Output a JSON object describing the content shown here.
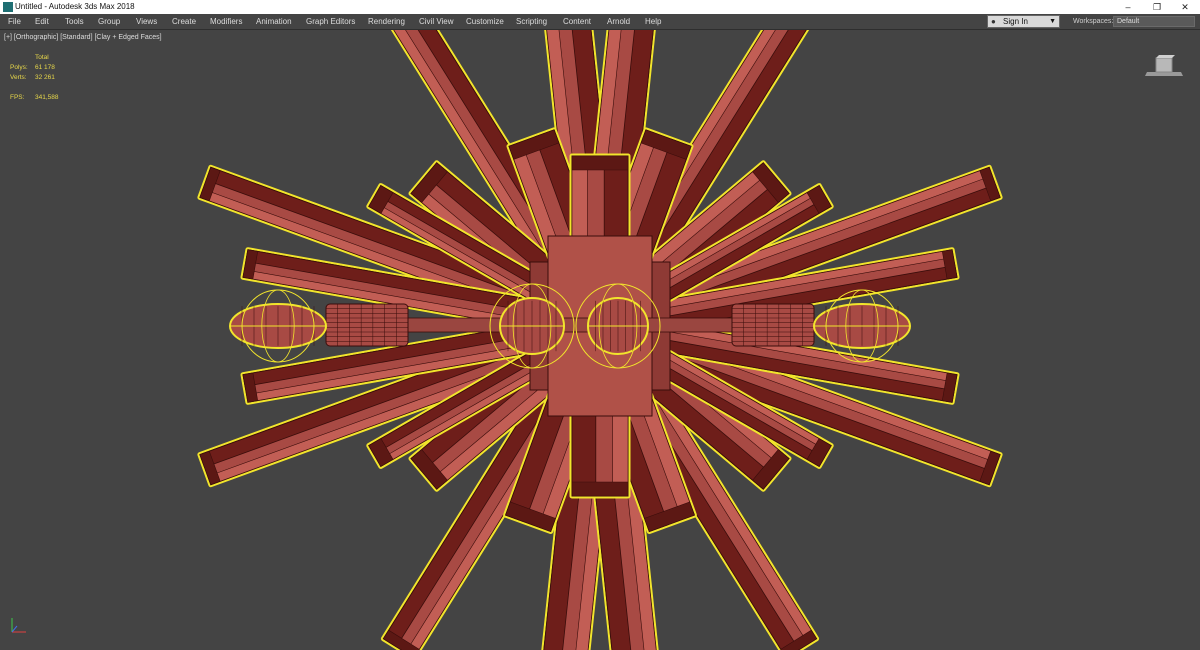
{
  "window": {
    "title": "Untitled - Autodesk 3ds Max 2018",
    "controls": [
      "–",
      "❐",
      "✕"
    ]
  },
  "menu": [
    "File",
    "Edit",
    "Tools",
    "Group",
    "Views",
    "Create",
    "Modifiers",
    "Animation",
    "Graph Editors",
    "Rendering",
    "Civil View",
    "Customize",
    "Scripting",
    "Content",
    "Arnold",
    "Help"
  ],
  "signin": {
    "label": "Sign In",
    "icon": "user-icon"
  },
  "workspaces": {
    "label": "Workspaces:",
    "value": "Default"
  },
  "viewport": {
    "label": "[+] [Orthographic] [Standard] [Clay + Edged Faces]",
    "stats": {
      "header": "Total",
      "polys_label": "Polys:",
      "polys_value": "61 178",
      "verts_label": "Verts:",
      "verts_value": "32 261",
      "fps_label": "FPS:",
      "fps_value": "341,588"
    }
  },
  "colors": {
    "background": "#444444",
    "clay": "#a84a44",
    "clay_dark": "#6e1e1a",
    "clay_light": "#c25e55",
    "wire": "#3a0d0b",
    "selection": "#f2e52c",
    "stats_text": "#e8d84a"
  }
}
